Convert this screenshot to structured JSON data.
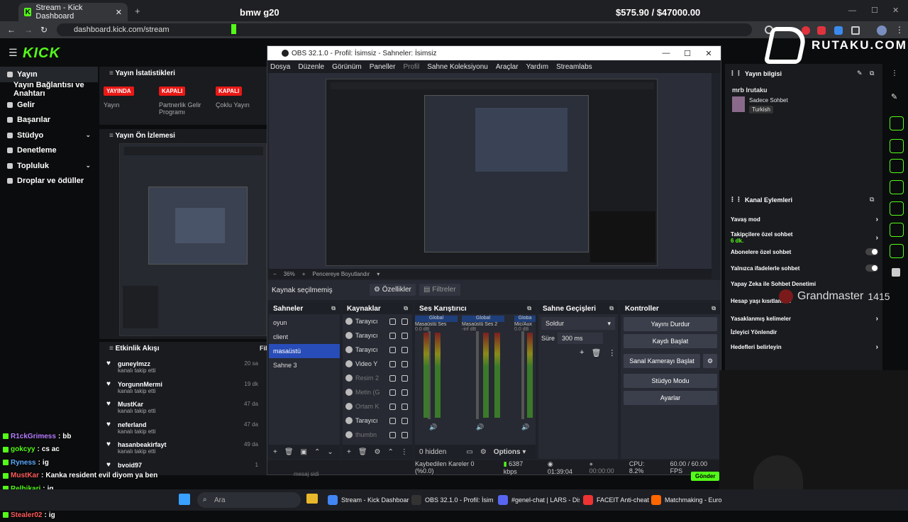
{
  "browser": {
    "tab_title": "Stream - Kick Dashboard",
    "url": "dashboard.kick.com/stream"
  },
  "overlay": {
    "title": "bmw g20",
    "price": "$575.90 / $47000.00",
    "brand": "RUTAKU.COM",
    "grandmaster": "Grandmaster",
    "rating": "1415"
  },
  "kick": {
    "logo": "KICK",
    "sidebar": [
      {
        "label": "Yayın",
        "active": true
      },
      {
        "label": "Yayın Bağlantısı ve Anahtarı"
      },
      {
        "label": "Gelir"
      },
      {
        "label": "Başarılar"
      },
      {
        "label": "Stüdyo",
        "arrow": true
      },
      {
        "label": "Denetleme"
      },
      {
        "label": "Topluluk",
        "arrow": true
      },
      {
        "label": "Droplar ve ödüller"
      }
    ],
    "stats_title": "Yayın İstatistikleri",
    "stats": [
      {
        "badge": "YAYINDA",
        "label": "Yayın"
      },
      {
        "badge": "KAPALI",
        "label": "Partnerlik Gelir Programı"
      },
      {
        "badge": "KAPALI",
        "label": "Çoklu Yayın"
      }
    ],
    "preview_title": "Yayın Ön İzlemesi",
    "activity_title": "Etkinlik Akışı",
    "filter_label": "Filt",
    "activity": [
      {
        "name": "guneylmzz",
        "sub": "kanalı takip etti",
        "time": "20 sa"
      },
      {
        "name": "YorgunnMermi",
        "sub": "kanalı takip etti",
        "time": "19 dk"
      },
      {
        "name": "MustKar",
        "sub": "kanalı takip etti",
        "time": "47 da"
      },
      {
        "name": "neferland",
        "sub": "kanalı takip etti",
        "time": "47 da"
      },
      {
        "name": "hasanbeakirfayt",
        "sub": "kanalı takip etti",
        "time": "49 da"
      },
      {
        "name": "bvoid97",
        "sub": "",
        "time": "1"
      }
    ]
  },
  "chat": [
    {
      "user": "R1ckGrimess",
      "color": "#b67cff",
      "msg": "bb"
    },
    {
      "user": "gokcyy",
      "color": "#53fc18",
      "msg": "cs ac"
    },
    {
      "user": "Ryness",
      "color": "#5aa8ff",
      "msg": "ig"
    },
    {
      "user": "MustKar",
      "color": "#ff5a5a",
      "msg": "Kanka resident evil diyom ya ben"
    },
    {
      "user": "Relhikari",
      "color": "#53fc18",
      "msg": "ig"
    },
    {
      "user": "9°C",
      "color": "#ffcc66",
      "msg": ""
    },
    {
      "user": "Stealer02",
      "color": "#ff5a5a",
      "msg": "ig"
    }
  ],
  "obs": {
    "title": "OBS 32.1.0 - Profil: İsimsiz - Sahneler: İsimsiz",
    "menu": [
      "Dosya",
      "Düzenle",
      "Görünüm",
      "Paneller",
      "Profil",
      "Sahne Koleksiyonu",
      "Araçlar",
      "Yardım",
      "Streamlabs"
    ],
    "zoom": "36%",
    "fit_label": "Pencereye Boyutlandır",
    "no_source": "Kaynak seçilmemiş",
    "properties": "Özellikler",
    "filters": "Filtreler",
    "scenes_title": "Sahneler",
    "scenes": [
      "oyun",
      "client",
      "masaüstü",
      "Sahne 3"
    ],
    "sources_title": "Kaynaklar",
    "sources": [
      {
        "name": "Tarayıcı",
        "dim": false
      },
      {
        "name": "Tarayıcı",
        "dim": false
      },
      {
        "name": "Tarayıcı",
        "dim": false
      },
      {
        "name": "Video Y",
        "dim": false
      },
      {
        "name": "Resim 2",
        "dim": true
      },
      {
        "name": "Metin (G",
        "dim": true
      },
      {
        "name": "Ortam K",
        "dim": true
      },
      {
        "name": "Tarayıcı",
        "dim": false
      },
      {
        "name": "thumbn",
        "dim": true
      }
    ],
    "mixer_title": "Ses Karıştırıcı",
    "mixer": [
      {
        "group": "Global",
        "name": "Masaüstü Ses",
        "db": "0.0 dB"
      },
      {
        "group": "Global",
        "name": "Masaüstü Ses 2",
        "db": "-inf dB"
      },
      {
        "group": "Globa",
        "name": "Mic/Aux",
        "db": "0.0 dB"
      }
    ],
    "mixer_hidden": "0 hidden",
    "options_label": "Options",
    "transitions_title": "Sahne Geçişleri",
    "transition": "Soldur",
    "duration_label": "Süre",
    "duration": "300 ms",
    "controls_title": "Kontroller",
    "controls": [
      "Yayını Durdur",
      "Kaydı Başlat",
      "Sanal Kamerayı Başlat",
      "Stüdyo Modu",
      "Ayarlar"
    ],
    "status": {
      "dropped": "Kaybedilen Kareler 0 (%0.0)",
      "bitrate": "6387 kbps",
      "live_time": "01:39:04",
      "rec_time": "00:00:00",
      "cpu": "CPU: 8.2%",
      "fps": "60.00 / 60.00 FPS"
    }
  },
  "right": {
    "info_title": "Yayın bilgisi",
    "stream_title": "mrb lrutaku",
    "category": "Sadece Sohbet",
    "language": "Turkish",
    "actions_title": "Kanal Eylemleri",
    "actions": [
      {
        "label": "Yavaş mod",
        "type": "chev"
      },
      {
        "label": "Takipçilere özel sohbet",
        "sub": "6 dk.",
        "type": "chev"
      },
      {
        "label": "Abonelere özel sohbet",
        "type": "toggle"
      },
      {
        "label": "Yalnızca ifadelerle sohbet",
        "type": "toggle"
      },
      {
        "label": "Yapay Zeka ile Sohbet Denetimi",
        "type": "none"
      },
      {
        "label": "Hesap yaşı kısıtlaması",
        "type": "none"
      },
      {
        "label": "Yasaklanmış kelimeler",
        "type": "chev"
      },
      {
        "label": "İzleyici Yönlendir",
        "type": "none"
      },
      {
        "label": "Hedefleri belirleyin",
        "type": "chev"
      }
    ],
    "send": "Gönder",
    "chat_placeholder": "mesaj sidi"
  },
  "taskbar": {
    "search": "Ara",
    "items": [
      "Stream - Kick Dashboard",
      "OBS 32.1.0 - Profil: İsimsiz",
      "#genel-chat | LARS - Dis",
      "FACEIT Anti-cheat",
      "Matchmaking - Euro"
    ]
  }
}
